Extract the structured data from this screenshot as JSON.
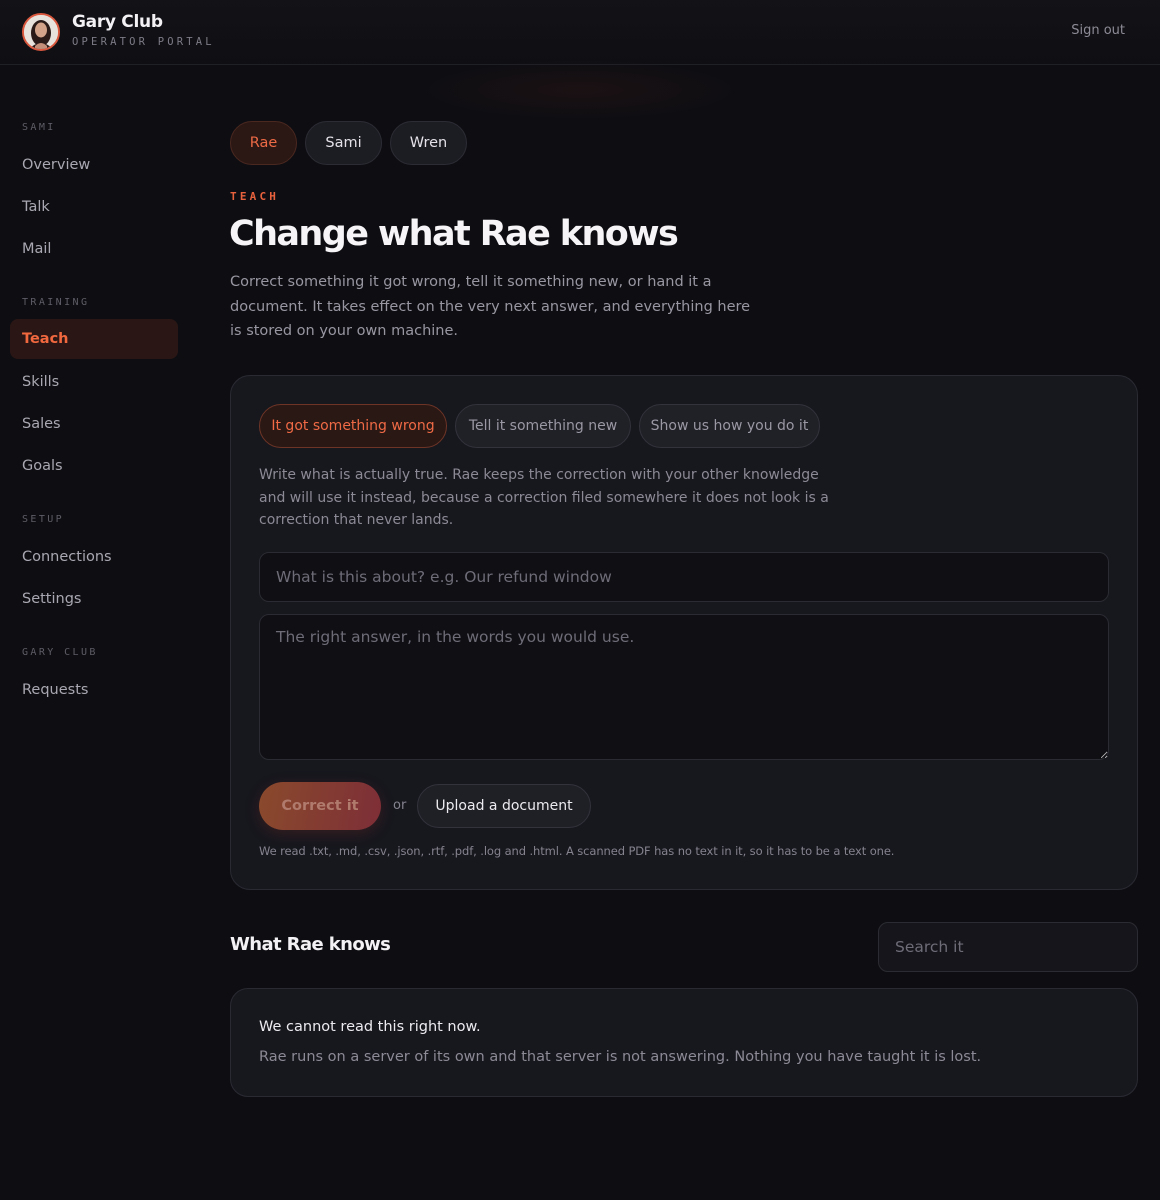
{
  "header": {
    "brand_name": "Gary Club",
    "brand_subtitle": "OPERATOR PORTAL",
    "sign_out": "Sign out",
    "avatar_icon": "user-avatar-icon"
  },
  "sidebar": {
    "sections": [
      {
        "label": "SAMI",
        "items": [
          {
            "label": "Overview",
            "active": false
          },
          {
            "label": "Talk",
            "active": false
          },
          {
            "label": "Mail",
            "active": false
          }
        ]
      },
      {
        "label": "TRAINING",
        "items": [
          {
            "label": "Teach",
            "active": true
          },
          {
            "label": "Skills",
            "active": false
          },
          {
            "label": "Sales",
            "active": false
          },
          {
            "label": "Goals",
            "active": false
          }
        ]
      },
      {
        "label": "SETUP",
        "items": [
          {
            "label": "Connections",
            "active": false
          },
          {
            "label": "Settings",
            "active": false
          }
        ]
      },
      {
        "label": "GARY CLUB",
        "items": [
          {
            "label": "Requests",
            "active": false
          }
        ]
      }
    ]
  },
  "agents": {
    "items": [
      {
        "label": "Rae",
        "selected": true
      },
      {
        "label": "Sami",
        "selected": false
      },
      {
        "label": "Wren",
        "selected": false
      }
    ]
  },
  "page": {
    "eyebrow": "TEACH",
    "title": "Change what Rae knows",
    "description": "Correct something it got wrong, tell it something new, or hand it a document. It takes effect on the very next answer, and everything here is stored on your own machine."
  },
  "teach_card": {
    "tabs": [
      {
        "label": "It got something wrong",
        "active": true
      },
      {
        "label": "Tell it something new",
        "active": false
      },
      {
        "label": "Show us how you do it",
        "active": false
      }
    ],
    "help_text": "Write what is actually true. Rae keeps the correction with your other knowledge and will use it instead, because a correction filed somewhere it does not look is a correction that never lands.",
    "topic_input": {
      "value": "",
      "placeholder": "What is this about? e.g. Our refund window"
    },
    "answer_input": {
      "value": "",
      "placeholder": "The right answer, in the words you would use."
    },
    "submit_label": "Correct it",
    "or_label": "or",
    "upload_label": "Upload a document",
    "file_note": "We read .txt, .md, .csv, .json, .rtf, .pdf, .log and .html. A scanned PDF has no text in it, so it has to be a text one."
  },
  "knowledge": {
    "title": "What Rae knows",
    "search": {
      "value": "",
      "placeholder": "Search it"
    },
    "error_title": "We cannot read this right now.",
    "error_body": "Rae runs on a server of its own and that server is not answering. Nothing you have taught it is lost."
  },
  "colors": {
    "accent": "#f1683f",
    "background": "#0e0e12",
    "card": "#17171e"
  }
}
